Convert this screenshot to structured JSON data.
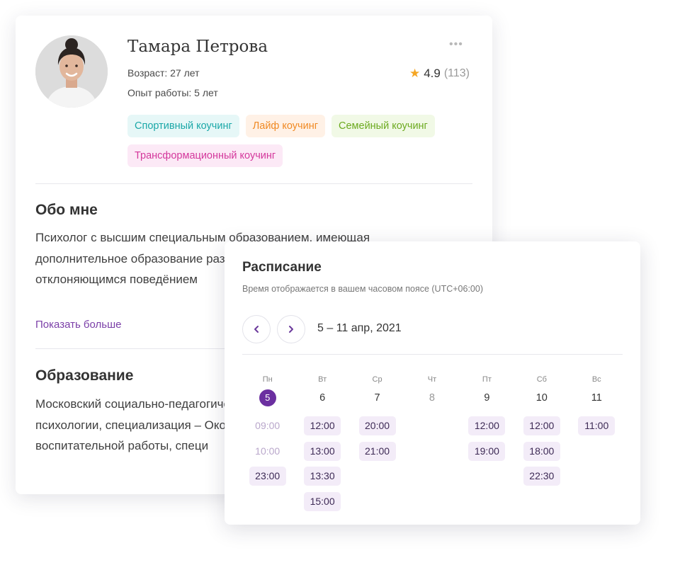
{
  "profile": {
    "name": "Тамара Петрова",
    "more_label": "•••",
    "age": "Возраст: 27 лет",
    "experience": "Опыт работы: 5 лет",
    "rating": {
      "value": "4.9",
      "count": "(113)"
    },
    "tags": [
      {
        "label": "Спортивный коучинг",
        "bg": "#e6f7f7",
        "color": "#1ba8a8"
      },
      {
        "label": "Лайф коучинг",
        "bg": "#fff1e6",
        "color": "#f08a24"
      },
      {
        "label": "Семейный коучинг",
        "bg": "#f1f9e6",
        "color": "#6caa1f"
      },
      {
        "label": "Трансформационный коучинг",
        "bg": "#fce9f6",
        "color": "#d4389c"
      }
    ],
    "about": {
      "title": "Обо мне",
      "text": "Психолог с высшим специальным образованием, имеющая дополнительное образование разработчиком учебной модели отклоняющимся поведёнием",
      "show_more": "Показать больше"
    },
    "education": {
      "title": "Образование",
      "text": "Московский социально-педагогический институт, факультет психологии, специализация – Окончила педагогический колледж воспитательной работы, специ"
    }
  },
  "schedule": {
    "title": "Расписание",
    "timezone_note": "Время отображается в вашем часовом поясе  (UTC+06:00)",
    "range": "5 – 11 апр, 2021",
    "accent": "#6b2fa0",
    "days": [
      {
        "dow": "Пн",
        "num": "5",
        "today": true,
        "muted": false,
        "slots": [
          {
            "time": "09:00",
            "disabled": true
          },
          {
            "time": "10:00",
            "disabled": true
          },
          {
            "time": "23:00",
            "disabled": false
          }
        ]
      },
      {
        "dow": "Вт",
        "num": "6",
        "today": false,
        "muted": false,
        "slots": [
          {
            "time": "12:00",
            "disabled": false
          },
          {
            "time": "13:00",
            "disabled": false
          },
          {
            "time": "13:30",
            "disabled": false
          },
          {
            "time": "15:00",
            "disabled": false
          }
        ]
      },
      {
        "dow": "Ср",
        "num": "7",
        "today": false,
        "muted": false,
        "slots": [
          {
            "time": "20:00",
            "disabled": false
          },
          {
            "time": "21:00",
            "disabled": false
          }
        ]
      },
      {
        "dow": "Чт",
        "num": "8",
        "today": false,
        "muted": true,
        "slots": []
      },
      {
        "dow": "Пт",
        "num": "9",
        "today": false,
        "muted": false,
        "slots": [
          {
            "time": "12:00",
            "disabled": false
          },
          {
            "time": "19:00",
            "disabled": false
          }
        ]
      },
      {
        "dow": "Сб",
        "num": "10",
        "today": false,
        "muted": false,
        "slots": [
          {
            "time": "12:00",
            "disabled": false
          },
          {
            "time": "18:00",
            "disabled": false
          },
          {
            "time": "22:30",
            "disabled": false
          }
        ]
      },
      {
        "dow": "Вс",
        "num": "11",
        "today": false,
        "muted": false,
        "slots": [
          {
            "time": "11:00",
            "disabled": false
          }
        ]
      }
    ]
  }
}
